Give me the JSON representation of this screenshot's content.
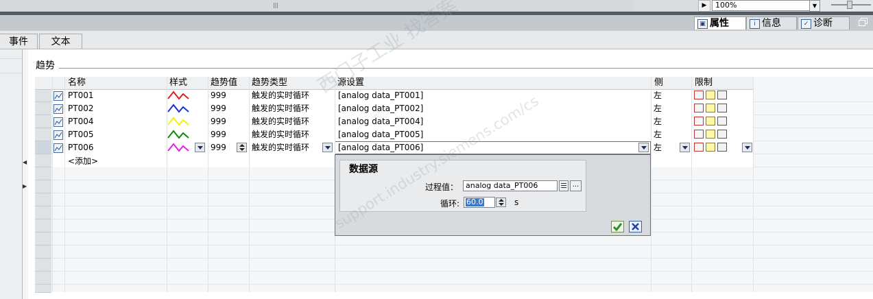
{
  "zoom": {
    "value": "100%"
  },
  "inspector_tabs": [
    {
      "label": "属性",
      "icon": "properties-icon",
      "active": true
    },
    {
      "label": "信息",
      "icon": "info-icon",
      "active": false
    },
    {
      "label": "诊断",
      "icon": "diagnostics-icon",
      "active": false
    }
  ],
  "sub_tabs": [
    {
      "label": "事件"
    },
    {
      "label": "文本"
    }
  ],
  "section": {
    "title": "趋势"
  },
  "grid": {
    "headers": {
      "name": "名称",
      "style": "样式",
      "trend_value": "趋势值",
      "trend_type": "趋势类型",
      "source": "源设置",
      "side": "侧",
      "limits": "限制"
    },
    "rows": [
      {
        "name": "PT001",
        "color": "#e02020",
        "trend_value": "999",
        "trend_type": "触发的实时循环",
        "source": "[analog data_PT001]",
        "side": "左"
      },
      {
        "name": "PT002",
        "color": "#1a2fd6",
        "trend_value": "999",
        "trend_type": "触发的实时循环",
        "source": "[analog data_PT002]",
        "side": "左"
      },
      {
        "name": "PT004",
        "color": "#f2f200",
        "trend_value": "999",
        "trend_type": "触发的实时循环",
        "source": "[analog data_PT004]",
        "side": "左"
      },
      {
        "name": "PT005",
        "color": "#0c8a0c",
        "trend_value": "999",
        "trend_type": "触发的实时循环",
        "source": "[analog data_PT005]",
        "side": "左"
      },
      {
        "name": "PT006",
        "color": "#e61ee6",
        "trend_value": "999",
        "trend_type": "触发的实时循环",
        "source": "[analog data_PT006]",
        "side": "左"
      }
    ],
    "add_label": "<添加>"
  },
  "popup": {
    "title": "数据源",
    "process_value_label": "过程值：",
    "process_value": "analog data_PT006",
    "cycle_label": "循环:",
    "cycle_value": "60.0",
    "cycle_unit": "s"
  },
  "watermark": {
    "line1": "西门子工业  找答案",
    "line2": "support.industry.siemens.com/cs"
  }
}
